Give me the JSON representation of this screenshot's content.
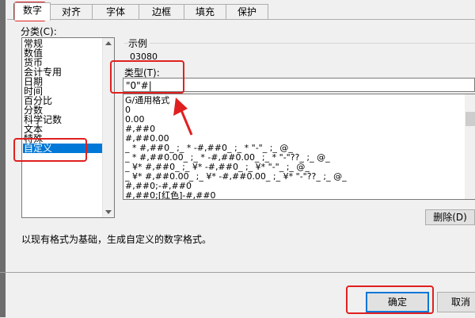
{
  "tabs": [
    {
      "label": "数字",
      "active": true
    },
    {
      "label": "对齐",
      "active": false
    },
    {
      "label": "字体",
      "active": false
    },
    {
      "label": "边框",
      "active": false
    },
    {
      "label": "填充",
      "active": false
    },
    {
      "label": "保护",
      "active": false
    }
  ],
  "category": {
    "label": "分类(C):",
    "items": [
      "常规",
      "数值",
      "货币",
      "会计专用",
      "日期",
      "时间",
      "百分比",
      "分数",
      "科学记数",
      "文本",
      "特殊",
      "自定义"
    ],
    "selected": "自定义"
  },
  "sample": {
    "label": "示例",
    "value": "03080"
  },
  "type": {
    "label": "类型(T):",
    "value": "\"0\"#|"
  },
  "formats": [
    "G/通用格式",
    "0",
    "0.00",
    "#,##0",
    "#,##0.00",
    "_ * #,##0_ ;_ * -#,##0_ ;_ * \"-\"_ ;_ @_",
    "_ * #,##0.00_ ;_ * -#,##0.00_ ;_ * \"-\"??_ ;_ @_",
    "_ ¥* #,##0_ ;_ ¥* -#,##0_ ;_ ¥* \"-\"_ ;_ @_",
    "_ ¥* #,##0.00_ ;_ ¥* -#,##0.00_ ;_ ¥* \"-\"??_ ;_ @_",
    "#,##0;-#,##0",
    "#,##0;[红色]-#,##0"
  ],
  "delete_button": "删除(D)",
  "description": "以现有格式为基础，生成自定义的数字格式。",
  "ok_button": "确定",
  "cancel_button": "取消",
  "colors": {
    "highlight": "#e02020",
    "selection": "#0078d7"
  }
}
